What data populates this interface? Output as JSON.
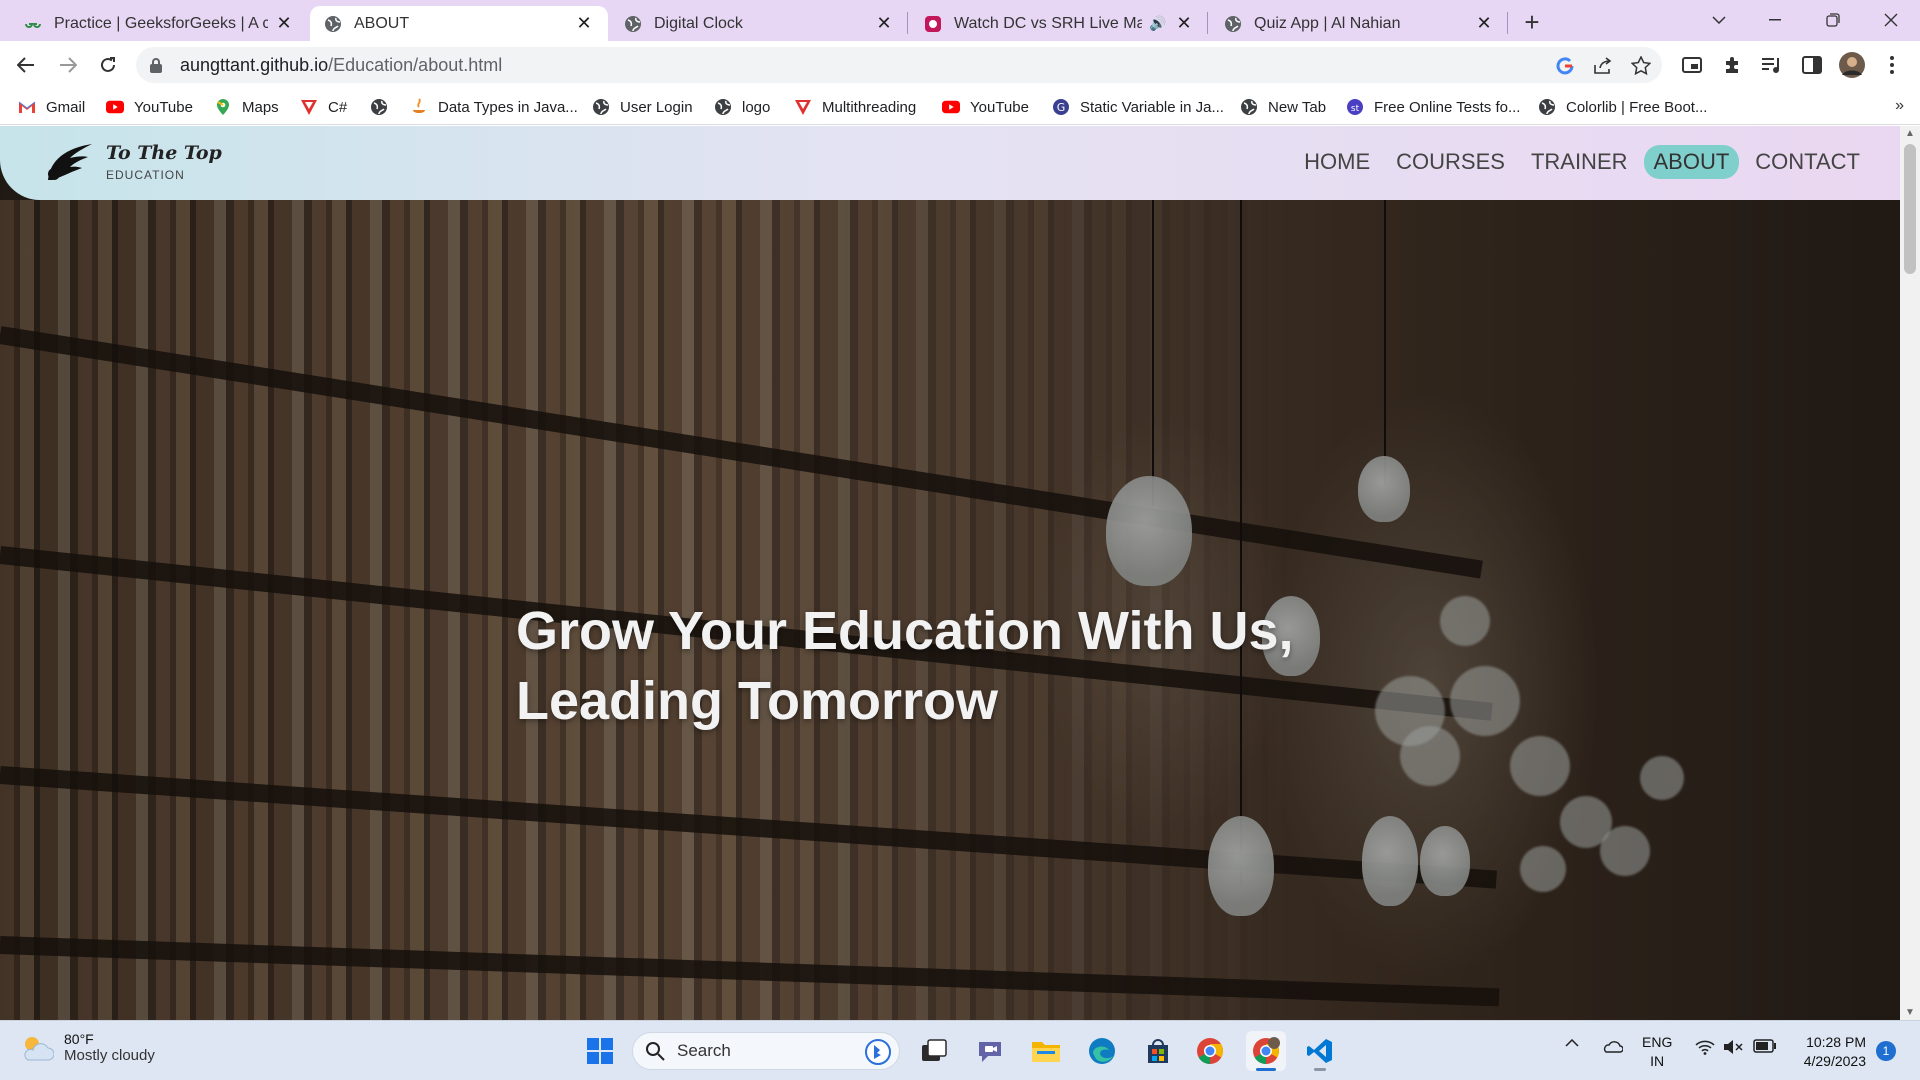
{
  "browser": {
    "tabs": [
      {
        "title": "Practice | GeeksforGeeks | A com",
        "icon": "geeksforgeeks-icon"
      },
      {
        "title": "ABOUT",
        "icon": "globe-icon",
        "active": true
      },
      {
        "title": "Digital Clock",
        "icon": "globe-icon"
      },
      {
        "title": "Watch DC vs SRH Live Match",
        "icon": "hotstar-icon",
        "audio": true
      },
      {
        "title": "Quiz App | Al Nahian",
        "icon": "globe-icon"
      }
    ],
    "new_tab": "+",
    "address": {
      "host": "aungttant.github.io",
      "path": "/Education/about.html"
    },
    "bookmarks": [
      {
        "label": "Gmail",
        "icon": "gmail-icon"
      },
      {
        "label": "YouTube",
        "icon": "youtube-icon"
      },
      {
        "label": "Maps",
        "icon": "maps-icon"
      },
      {
        "label": "C#",
        "icon": "v-logo-icon"
      },
      {
        "label": "",
        "icon": "globe-icon"
      },
      {
        "label": "Data Types in Java...",
        "icon": "java-icon"
      },
      {
        "label": "User Login",
        "icon": "globe-icon"
      },
      {
        "label": "logo",
        "icon": "globe-icon"
      },
      {
        "label": "Multithreading",
        "icon": "v-logo-icon"
      },
      {
        "label": "YouTube",
        "icon": "youtube-icon"
      },
      {
        "label": "Static Variable in Ja...",
        "icon": "letter-s-icon"
      },
      {
        "label": "New Tab",
        "icon": "globe-icon"
      },
      {
        "label": "Free Online Tests fo...",
        "icon": "st-icon"
      },
      {
        "label": "Colorlib | Free Boot...",
        "icon": "globe-icon"
      }
    ],
    "bookmarks_more": "»"
  },
  "site": {
    "brand_line1": "To The Top",
    "brand_line2": "EDUCATION",
    "menu": [
      "HOME",
      "COURSES",
      "TRAINER",
      "ABOUT",
      "CONTACT"
    ],
    "active_menu": "ABOUT",
    "hero_line1": "Grow Your Education With Us,",
    "hero_line2": "Leading Tomorrow"
  },
  "taskbar": {
    "weather_temp": "80°F",
    "weather_condition": "Mostly cloudy",
    "search_placeholder": "Search",
    "apps": [
      "windows-start-icon",
      "search-icon",
      "bing-icon",
      "task-view-icon",
      "teams-chat-icon",
      "file-explorer-icon",
      "edge-icon",
      "store-icon",
      "chrome-icon",
      "chrome-profile-icon",
      "vscode-icon"
    ],
    "lang_line1": "ENG",
    "lang_line2": "IN",
    "time": "10:28 PM",
    "date": "4/29/2023",
    "notification_count": "1"
  },
  "colors": {
    "tabstrip": "#e7d7f5",
    "nav_active": "#7fd0cc",
    "taskbar": "#dde6f2",
    "accent": "#1f6fd1"
  }
}
